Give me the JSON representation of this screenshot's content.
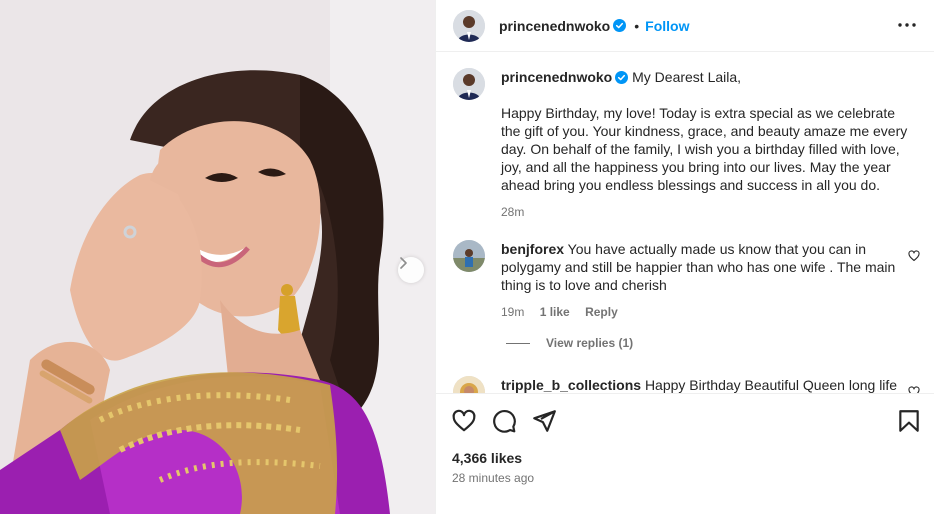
{
  "post": {
    "author": "princenednwoko",
    "follow_label": "Follow",
    "separator": "•",
    "more_icon": "more-horizontal-icon",
    "accent": "#0095f6"
  },
  "caption": {
    "author": "princenednwoko",
    "greeting": "My Dearest Laila,",
    "body": "Happy Birthday, my love! Today is extra special as we celebrate the gift of you. Your kindness, grace, and beauty amaze me every day. On behalf of the family, I wish you a birthday filled with love, joy, and all the happiness you bring into our lives. May the year ahead bring you endless blessings and success in all you do.",
    "time": "28m"
  },
  "comments": [
    {
      "author": "benjforex",
      "text": "You have actually made us know that you can in polygamy and still be happier than who has one wife . The main thing is to love and cherish",
      "time": "19m",
      "likes": "1 like",
      "reply_label": "Reply",
      "view_replies": "View replies (1)"
    },
    {
      "author": "tripple_b_collections",
      "text": "Happy Birthday Beautiful Queen long life"
    }
  ],
  "footer": {
    "likes": "4,366 likes",
    "time": "28 minutes ago"
  }
}
